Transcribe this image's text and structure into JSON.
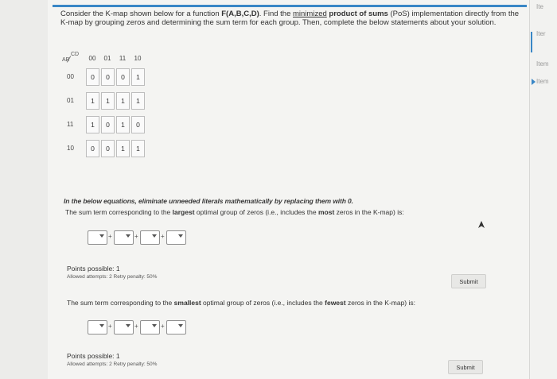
{
  "question": {
    "part1": "Consider the K-map shown below for a function ",
    "func": "F(A,B,C,D)",
    "part2": ". Find the ",
    "minimized": "minimized",
    "pos_bold": " product of sums",
    "part3": " (PoS) implementation directly from the K-map by grouping zeros and determining the sum term for each group. Then, complete the below statements about your solution."
  },
  "kmap": {
    "row_var": "AB",
    "col_var": "CD",
    "col_labels": [
      "00",
      "01",
      "11",
      "10"
    ],
    "row_labels": [
      "00",
      "01",
      "11",
      "10"
    ],
    "cells": [
      [
        "0",
        "0",
        "0",
        "1"
      ],
      [
        "1",
        "1",
        "1",
        "1"
      ],
      [
        "1",
        "0",
        "1",
        "0"
      ],
      [
        "0",
        "0",
        "1",
        "1"
      ]
    ]
  },
  "instruction": "In the below equations, eliminate unneeded literals mathematically by replacing them with 0.",
  "q1": {
    "pre": "The sum term corresponding to the ",
    "kw": "largest",
    "mid": " optimal group of zeros (i.e., includes the ",
    "kw2": "most",
    "post": " zeros in the K-map) is:",
    "points": "Points possible: 1",
    "attempts": "Allowed attempts: 2   Retry penalty: 50%",
    "submit": "Submit"
  },
  "q2": {
    "pre": "The sum term corresponding to the ",
    "kw": "smallest",
    "mid": " optimal group of zeros (i.e., includes the ",
    "kw2": "fewest",
    "post": " zeros in the K-map) is:",
    "points": "Points possible: 1",
    "attempts": "Allowed attempts: 2   Retry penalty: 50%",
    "submit": "Submit"
  },
  "plus_sign": "+",
  "right_panel": {
    "items": [
      "Ite",
      "Iter",
      "Item",
      "Item"
    ]
  },
  "colors": {
    "accent": "#3a87c6",
    "page_bg": "#f4f4f2"
  }
}
